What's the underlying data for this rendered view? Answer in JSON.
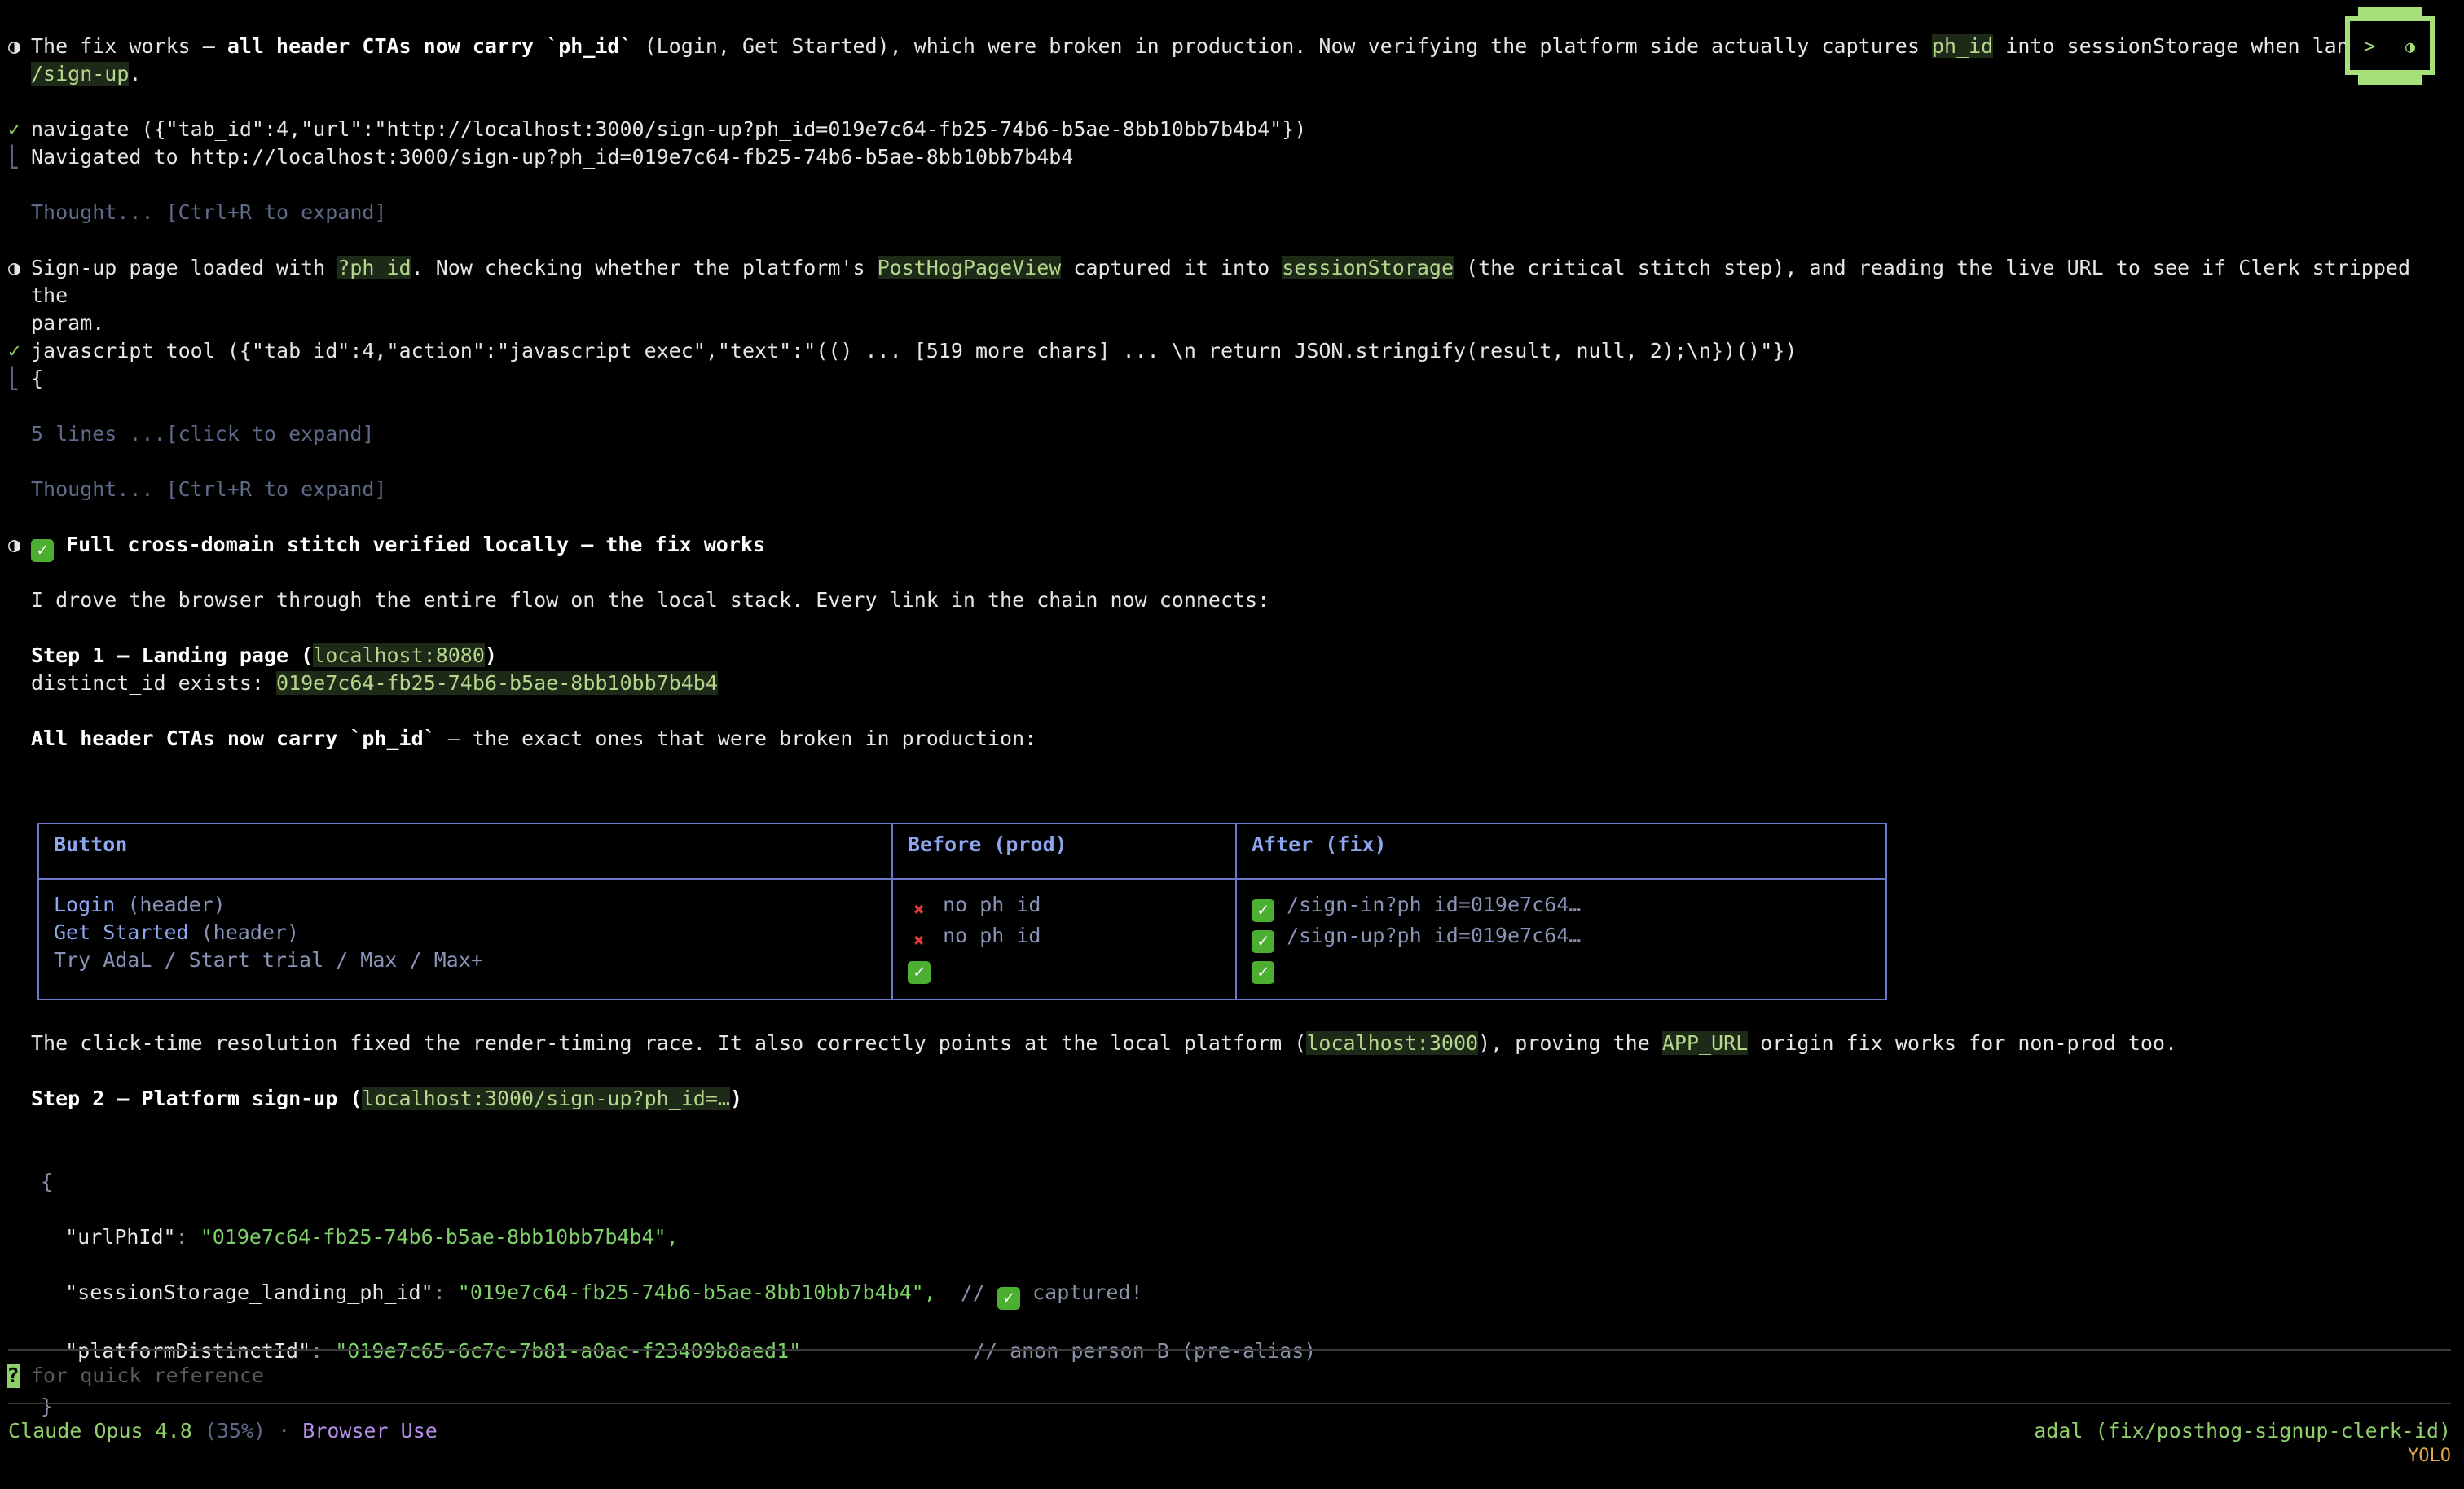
{
  "para1": {
    "lead": "The fix works — ",
    "bold": "all header CTAs now carry `ph_id`",
    "mid": " (Login, Get Started), which were broken in production. Now verifying the platform side actually captures ",
    "code1": "ph_id",
    "tail": " into sessionStorage when landing on",
    "code2": "/sign-up",
    "end": "."
  },
  "tool1": {
    "call": "navigate ({\"tab_id\":4,\"url\":\"http://localhost:3000/sign-up?ph_id=019e7c64-fb25-74b6-b5ae-8bb10bb7b4b4\"})",
    "result": "Navigated to http://localhost:3000/sign-up?ph_id=019e7c64-fb25-74b6-b5ae-8bb10bb7b4b4"
  },
  "thought_label": "Thought... [Ctrl+R to expand]",
  "para2": {
    "a": "Sign-up page loaded with ",
    "c1": "?ph_id",
    "b": ". Now checking whether the platform's ",
    "c2": "PostHogPageView",
    "c": " captured it into ",
    "c3": "sessionStorage",
    "d": " (the critical stitch step), and reading the live URL to see if Clerk stripped the",
    "e": "param."
  },
  "tool2": {
    "call": "javascript_tool ({\"tab_id\":4,\"action\":\"javascript_exec\",\"text\":\"(() ... [519 more chars] ... \\n return JSON.stringify(result, null, 2);\\n})()\"})",
    "result": "{",
    "collapsed": "5 lines ...[click to expand]"
  },
  "summary": {
    "heading": "Full cross-domain stitch verified locally — the fix works",
    "intro": "I drove the browser through the entire flow on the local stack. Every link in the chain now connects:",
    "step1_a": "Step 1 — Landing page (",
    "step1_code": "localhost:8080",
    "step1_b": ")",
    "distinct_label": "distinct_id exists: ",
    "distinct_value": "019e7c64-fb25-74b6-b5ae-8bb10bb7b4b4",
    "ctas_bold": "All header CTAs now carry `ph_id`",
    "ctas_rest": " — the exact ones that were broken in production:"
  },
  "table": {
    "headers": [
      "Button",
      "Before (prod)",
      "After (fix)"
    ],
    "rows": [
      {
        "label": "Login",
        "note": " (header)",
        "before": "no ph_id",
        "before_ok": false,
        "after": "/sign-in?ph_id=019e7c64…"
      },
      {
        "label": "Get Started",
        "note": " (header)",
        "before": "no ph_id",
        "before_ok": false,
        "after": "/sign-up?ph_id=019e7c64…"
      },
      {
        "label": "",
        "note": "Try AdaL / Start trial / Max / Max+",
        "before": "",
        "before_ok": true,
        "after": ""
      }
    ]
  },
  "para3": {
    "a": "The click-time resolution fixed the render-timing race. It also correctly points at the local platform (",
    "c1": "localhost:3000",
    "b": "), proving the ",
    "c2": "APP_URL",
    "c": " origin fix works for non-prod too."
  },
  "step2": {
    "a": "Step 2 — Platform sign-up (",
    "code": "localhost:3000/sign-up?ph_id=…",
    "b": ")"
  },
  "json_block": {
    "open": "{",
    "k1": "\"urlPhId\"",
    "v1": "\"019e7c64-fb25-74b6-b5ae-8bb10bb7b4b4\",",
    "k2": "\"sessionStorage_landing_ph_id\"",
    "v2": "\"019e7c64-fb25-74b6-b5ae-8bb10bb7b4b4\",",
    "c2": "//",
    "c2b": " captured!",
    "k3": "\"platformDistinctId\"",
    "v3": "\"019e7c65-6c7c-7b81-a0ac-f23409b8aed1\"",
    "c3": "// anon person B (pre-alias)",
    "close": "}"
  },
  "input": {
    "prompt_char": "?",
    "placeholder": "for quick reference"
  },
  "status": {
    "model": "Claude Opus 4.8",
    "context": " (35%)",
    "sep": " · ",
    "mode": "Browser Use",
    "repo": "adal",
    "branch": " (fix/posthog-signup-clerk-id)",
    "yolo": "YOLO"
  },
  "icons": {
    "bullet": "half-circle-icon",
    "check": "checkmark-icon",
    "ok": "green-check-emoji",
    "no": "red-x-emoji"
  },
  "colors": {
    "background": "#000000",
    "accent_green": "#8fcf6a",
    "table_border": "#6c77c9",
    "dim": "#5f6a8a",
    "purple": "#b48ee6",
    "yolo": "#e0a84a"
  }
}
